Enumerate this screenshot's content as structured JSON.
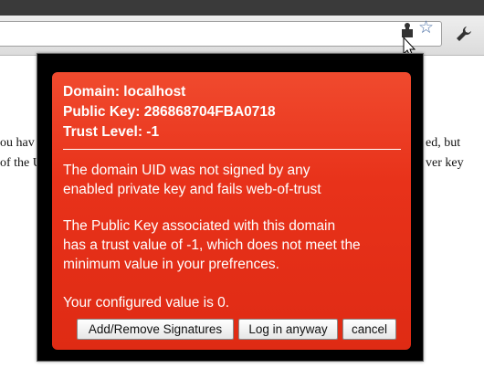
{
  "browser": {
    "toolbar_icons": [
      "puzzle-extension-icon",
      "bookmark-star-icon",
      "wrench-icon"
    ]
  },
  "page_background": {
    "left_fragments": [
      "ou hav",
      "of the U"
    ],
    "right_fragments": [
      "ed, but",
      "ver key"
    ]
  },
  "popup": {
    "domain_line": "Domain: localhost",
    "public_key_line": "Public Key: 286868704FBA0718",
    "trust_level_line": "Trust Level: -1",
    "message1": [
      "The domain UID was not signed by any",
      "enabled private key and fails web-of-trust"
    ],
    "message2": [
      "The Public Key associated with this domain",
      "has a trust value of -1, which does not meet the",
      "minimum value in your prefrences."
    ],
    "configured": "Your configured value is 0.",
    "buttons": {
      "add_remove": "Add/Remove Signatures",
      "log_in": "Log in anyway",
      "cancel": "cancel"
    },
    "colors": {
      "panel": "#e8321a",
      "frame": "#000000"
    }
  }
}
